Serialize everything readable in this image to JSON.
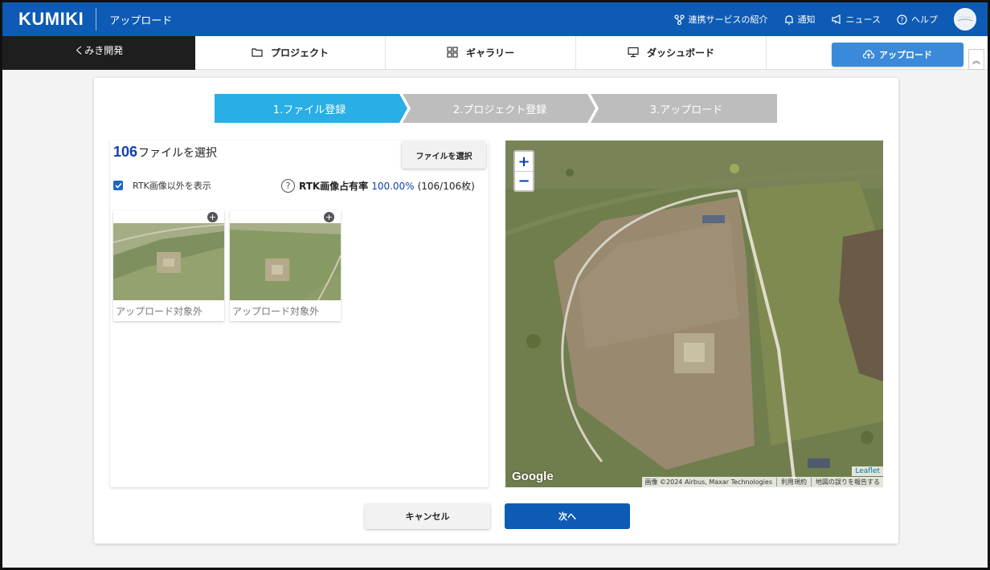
{
  "header": {
    "logo": "KUMIKI",
    "page_title": "アップロード",
    "links": [
      {
        "label": "連携サービスの紹介",
        "icon": "share-icon"
      },
      {
        "label": "通知",
        "icon": "bell-icon"
      },
      {
        "label": "ニュース",
        "icon": "megaphone-icon"
      },
      {
        "label": "ヘルプ",
        "icon": "help-circle-icon"
      }
    ],
    "brand_color": "#0d5bb5"
  },
  "nav": {
    "org": "くみき開発",
    "tabs": [
      {
        "label": "プロジェクト",
        "icon": "folder-icon"
      },
      {
        "label": "ギャラリー",
        "icon": "grid-icon"
      },
      {
        "label": "ダッシュボード",
        "icon": "monitor-icon"
      }
    ],
    "upload_label": "アップロード",
    "collapse_label": "︽"
  },
  "stepper": {
    "steps": [
      {
        "label": "1.ファイル登録",
        "active": true
      },
      {
        "label": "2.プロジェクト登録",
        "active": false
      },
      {
        "label": "3.アップロード",
        "active": false
      }
    ],
    "active_color": "#29aee6",
    "inactive_color": "#bdbdbd"
  },
  "files": {
    "count": "106",
    "count_suffix": "ファイルを選択",
    "select_button": "ファイルを選択",
    "show_non_rtk_label": "RTK画像以外を表示",
    "show_non_rtk_checked": true,
    "rtk_rate_label": "RTK画像占有率",
    "rtk_rate_value": "100.00%",
    "rtk_rate_count": "(106/106枚)",
    "thumbnails": [
      {
        "caption": "アップロード対象外"
      },
      {
        "caption": "アップロード対象外"
      }
    ]
  },
  "map": {
    "zoom_in": "+",
    "zoom_out": "−",
    "google": "Google",
    "leaflet": "Leaflet",
    "attributions": [
      "画像 ©2024 Airbus, Maxar Technologies",
      "利用規約",
      "地図の誤りを報告する"
    ]
  },
  "footer": {
    "cancel": "キャンセル",
    "next": "次へ"
  }
}
